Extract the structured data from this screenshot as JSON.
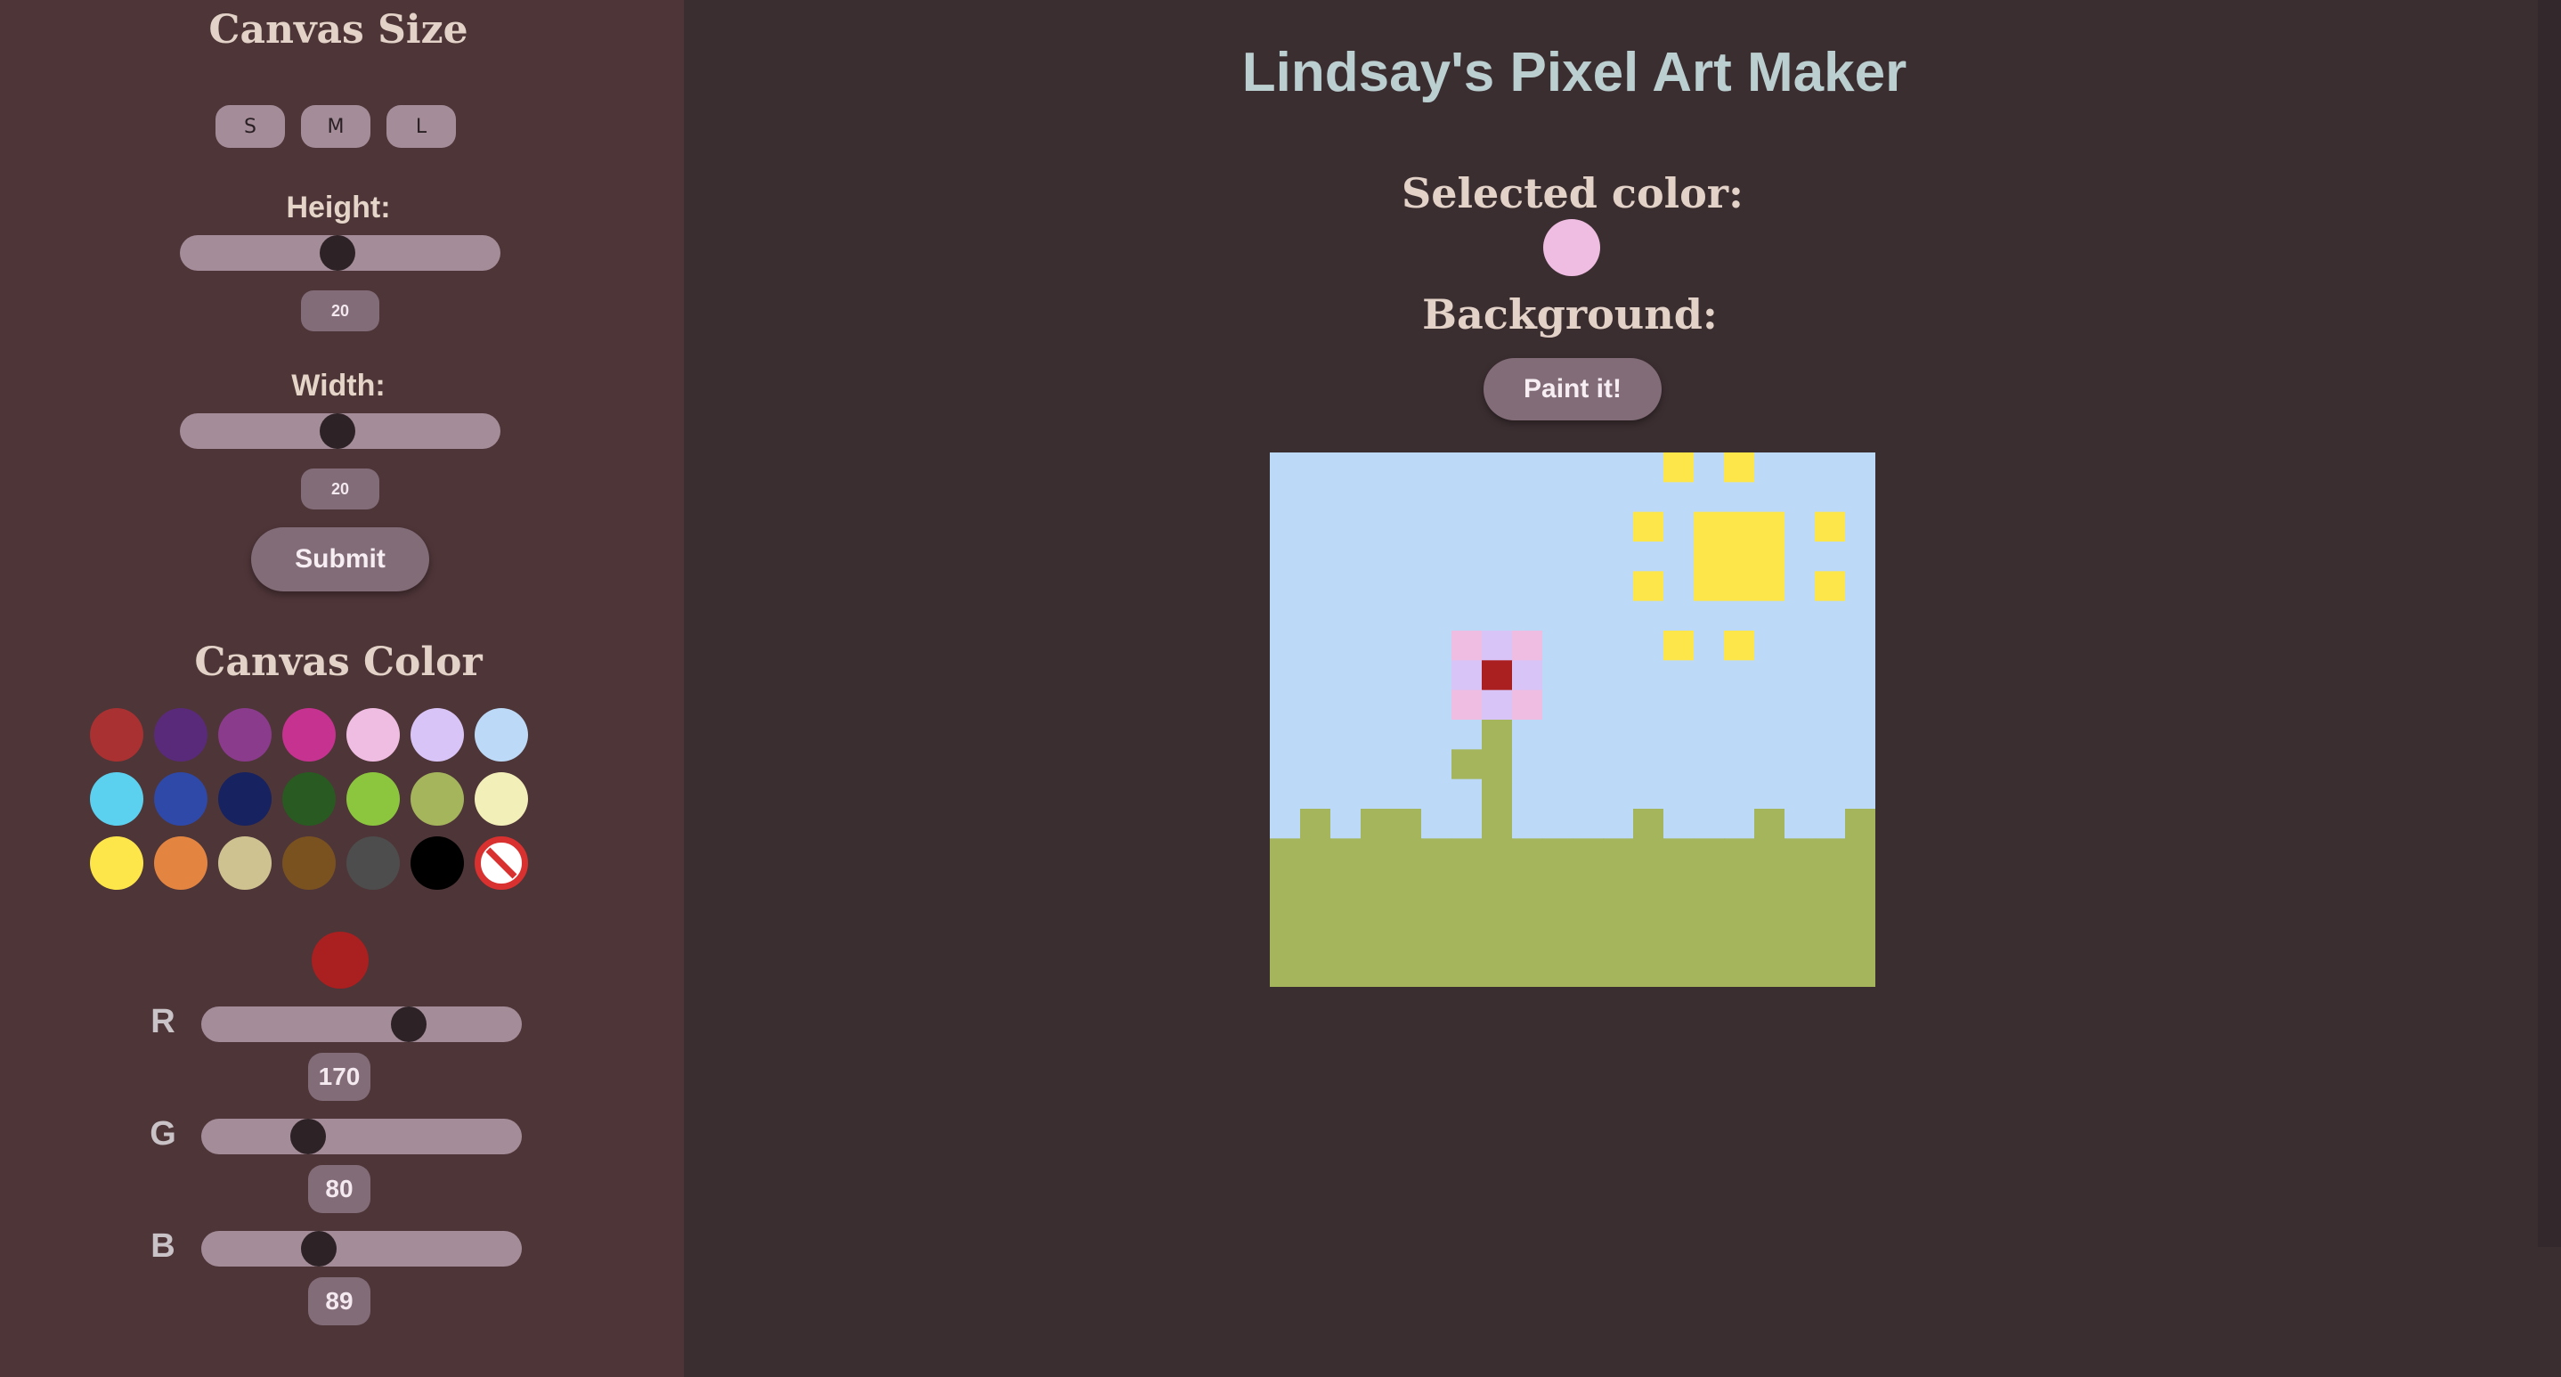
{
  "sidebar": {
    "canvas_size_title": "Canvas Size",
    "size_buttons": [
      "S",
      "M",
      "L"
    ],
    "height_label": "Height:",
    "height_value": "20",
    "height_fraction": 0.49,
    "width_label": "Width:",
    "width_value": "20",
    "width_fraction": 0.49,
    "submit_label": "Submit",
    "canvas_color_title": "Canvas Color",
    "palette": [
      "#a93131",
      "#5a2a7a",
      "#8a3b8c",
      "#c63290",
      "#f0bde2",
      "#d8c4f7",
      "#bcdaf7",
      "#5cd1ef",
      "#2e49a8",
      "#172260",
      "#285a22",
      "#8cc63e",
      "#a4b55c",
      "#f3efb8",
      "#fde64a",
      "#e38540",
      "#cfc291",
      "#7a5220",
      "#4d4d4d",
      "#000000",
      "none"
    ],
    "current_color": "#aa1f1f",
    "r_label": "R",
    "r_value": "170",
    "r_fraction": 0.667,
    "g_label": "G",
    "g_value": "80",
    "g_fraction": 0.314,
    "b_label": "B",
    "b_value": "89",
    "b_fraction": 0.349
  },
  "main": {
    "title": "Lindsay's Pixel Art Maker",
    "selected_color_label": "Selected color:",
    "selected_color": "#f0bde2",
    "background_label": "Background:",
    "paint_label": "Paint it!",
    "grid": {
      "cols": 20,
      "rows": 18,
      "colors": {
        "S": "#bcdaf7",
        "G": "#a4b55c",
        "Y": "#fde64a",
        "P": "#f0bde2",
        "L": "#d8c4f7",
        "R": "#aa1f1f"
      },
      "pixels": [
        "SSSSSSSSSSSSSYSYSSSS",
        "SSSSSSSSSSSSSSSSSSSS",
        "SSSSSSSSSSSSYSYYYSYS",
        "SSSSSSSSSSSSSSYYYSSS",
        "SSSSSSSSSSSSYSYYYSYS",
        "SSSSSSSSSSSSSSSSSSSS",
        "SSSSSSPLPSSSSYSYSSSS",
        "SSSSSSLRLSSSSSSSSSSS",
        "SSSSSSPLPSSSSSSSSSSS",
        "SSSSSSSGSSSSSSSSSSSS",
        "SSSSSSGGSSSSSSSSSSSS",
        "SSSSSSSGSSSSSSSSSSSS",
        "SGSGGSSGSSSSGSSSGSSG",
        "GGGGGGGGGGGGGGGGGGGG",
        "GGGGGGGGGGGGGGGGGGGG",
        "GGGGGGGGGGGGGGGGGGGG",
        "GGGGGGGGGGGGGGGGGGGG",
        "GGGGGGGGGGGGGGGGGGGG"
      ]
    }
  }
}
